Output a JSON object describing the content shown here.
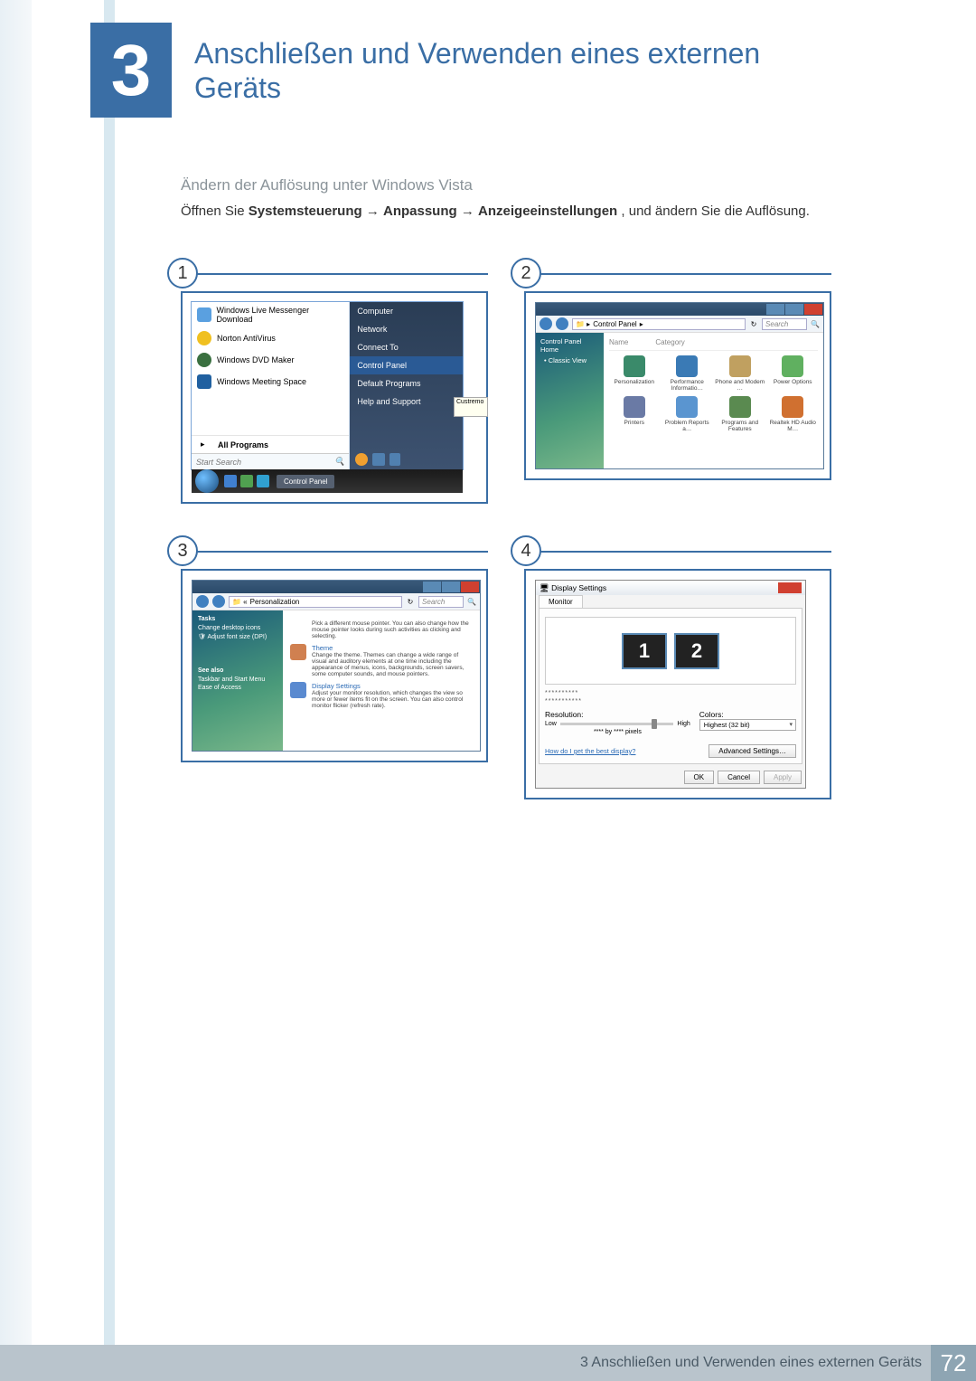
{
  "chapter": {
    "number": "3",
    "title": "Anschließen und Verwenden eines externen Geräts"
  },
  "section_title": "Ändern der Auflösung unter Windows Vista",
  "instruction": {
    "prefix": "Öffnen Sie ",
    "path1": "Systemsteuerung",
    "arrow": " → ",
    "path2": "Anpassung",
    "path3": "Anzeigeeinstellungen",
    "suffix": ", und ändern Sie die Auflösung."
  },
  "fig_labels": [
    "1",
    "2",
    "3",
    "4"
  ],
  "start_menu": {
    "items": [
      "Windows Live Messenger Download",
      "Norton AntiVirus",
      "Windows DVD Maker",
      "Windows Meeting Space"
    ],
    "all_programs": "All Programs",
    "search": "Start Search",
    "right_items": [
      "Computer",
      "Network",
      "Connect To",
      "Control Panel",
      "Default Programs",
      "Help and Support"
    ],
    "tooltip": "Custremo",
    "taskbar_item": "Control Panel"
  },
  "control_panel": {
    "breadcrumb": "Control Panel",
    "search_placeholder": "Search",
    "side_items": [
      "Control Panel Home",
      "Classic View"
    ],
    "headers": [
      "Name",
      "Category"
    ],
    "icons": [
      {
        "label": "Personalization",
        "color": "#3a8a6a"
      },
      {
        "label": "Performance Informatio…",
        "color": "#3a7ab5"
      },
      {
        "label": "Phone and Modem …",
        "color": "#c0a060"
      },
      {
        "label": "Power Options",
        "color": "#60b060"
      },
      {
        "label": "Printers",
        "color": "#6a7aa5"
      },
      {
        "label": "Problem Reports a…",
        "color": "#5a95d0"
      },
      {
        "label": "Programs and Features",
        "color": "#5a8a50"
      },
      {
        "label": "Realtek HD Audio M…",
        "color": "#d07030"
      }
    ]
  },
  "personalization": {
    "breadcrumb": "Personalization",
    "search_placeholder": "Search",
    "side": {
      "tasks_hdr": "Tasks",
      "tasks": [
        "Change desktop icons",
        "Adjust font size (DPI)"
      ],
      "seealso_hdr": "See also",
      "seealso": [
        "Taskbar and Start Menu",
        "Ease of Access"
      ]
    },
    "entries": [
      {
        "title": "",
        "desc": "Pick a different mouse pointer. You can also change how the mouse pointer looks during such activities as clicking and selecting.",
        "color": "#fff"
      },
      {
        "title": "Theme",
        "desc": "Change the theme. Themes can change a wide range of visual and auditory elements at one time including the appearance of menus, icons, backgrounds, screen savers, some computer sounds, and mouse pointers.",
        "color": "#d08050"
      },
      {
        "title": "Display Settings",
        "desc": "Adjust your monitor resolution, which changes the view so more or fewer items fit on the screen. You can also control monitor flicker (refresh rate).",
        "color": "#5a8ad0"
      }
    ]
  },
  "display_settings": {
    "title": "Display Settings",
    "tab": "Monitor",
    "monitors": [
      "1",
      "2"
    ],
    "stars1": "**********",
    "stars2": "***********",
    "res_label": "Resolution:",
    "low": "Low",
    "high": "High",
    "pixels": "**** by **** pixels",
    "colors_label": "Colors:",
    "colors_value": "Highest (32 bit)",
    "help_link": "How do I get the best display?",
    "advanced": "Advanced Settings…",
    "ok": "OK",
    "cancel": "Cancel",
    "apply": "Apply"
  },
  "footer": {
    "text": "3 Anschließen und Verwenden eines externen Geräts",
    "page": "72"
  }
}
